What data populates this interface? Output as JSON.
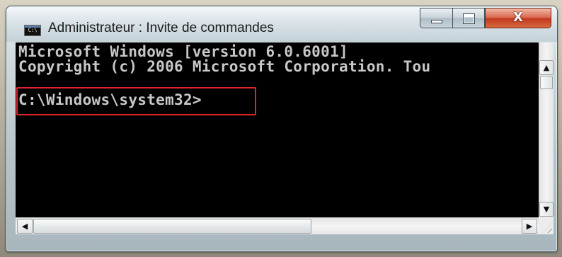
{
  "window": {
    "title": "Administrateur : Invite de commandes",
    "icon": "console-icon",
    "icon_text": "C:\\",
    "controls": {
      "minimize": "minimize-icon",
      "maximize": "maximize-icon",
      "close": "close-icon",
      "close_glyph": "X"
    }
  },
  "console": {
    "lines": [
      "Microsoft Windows [version 6.0.6001]",
      "Copyright (c) 2006 Microsoft Corporation. Tou"
    ],
    "prompt": "C:\\Windows\\system32>",
    "background_color": "#000000",
    "text_color": "#c8c8c8",
    "highlight_color": "#e0242b"
  },
  "scrollbars": {
    "up_arrow": "▲",
    "down_arrow": "▼",
    "left_arrow": "◀",
    "right_arrow": "▶"
  }
}
